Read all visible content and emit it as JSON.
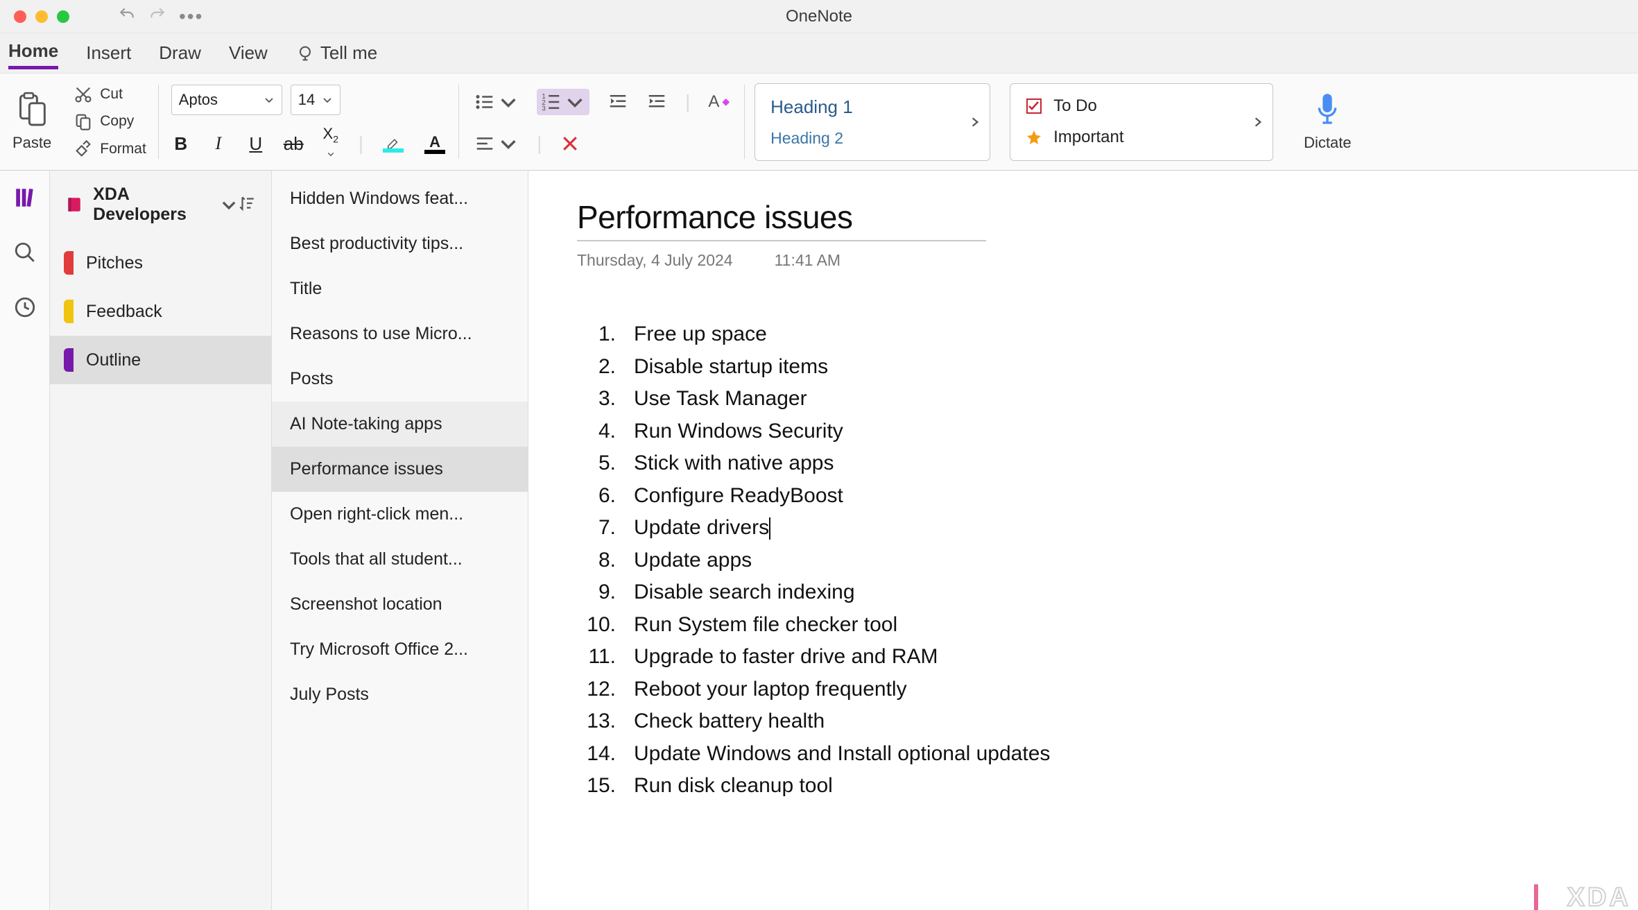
{
  "app": {
    "title": "OneNote"
  },
  "tabs": {
    "items": [
      "Home",
      "Insert",
      "Draw",
      "View"
    ],
    "tellme": "Tell me",
    "active": "Home"
  },
  "ribbon": {
    "paste": "Paste",
    "cut": "Cut",
    "copy": "Copy",
    "format": "Format",
    "font_name": "Aptos",
    "font_size": "14",
    "styles": {
      "heading1": "Heading 1",
      "heading2": "Heading 2"
    },
    "tags": {
      "todo": "To Do",
      "important": "Important"
    },
    "dictate": "Dictate"
  },
  "notebook": {
    "name": "XDA Developers"
  },
  "sections": [
    {
      "label": "Pitches",
      "color": "st-red"
    },
    {
      "label": "Feedback",
      "color": "st-yellow"
    },
    {
      "label": "Outline",
      "color": "st-purple",
      "active": true
    }
  ],
  "pages": [
    {
      "label": "Hidden Windows feat..."
    },
    {
      "label": "Best productivity tips..."
    },
    {
      "label": "Title"
    },
    {
      "label": "Reasons to use Micro..."
    },
    {
      "label": "Posts"
    },
    {
      "label": "AI Note-taking apps",
      "hover": true
    },
    {
      "label": "Performance issues",
      "active": true
    },
    {
      "label": "Open right-click men..."
    },
    {
      "label": "Tools that all student..."
    },
    {
      "label": "Screenshot location"
    },
    {
      "label": "Try Microsoft Office 2..."
    },
    {
      "label": "July Posts"
    }
  ],
  "page": {
    "title": "Performance issues",
    "date": "Thursday, 4 July 2024",
    "time": "11:41 AM",
    "list": [
      "Free up space",
      "Disable startup items",
      "Use Task Manager",
      "Run Windows Security",
      "Stick with native apps",
      "Configure ReadyBoost",
      "Update drivers",
      "Update apps",
      "Disable search indexing",
      "Run System file checker tool",
      "Upgrade to faster drive and RAM",
      "Reboot your laptop frequently",
      "Check battery health",
      "Update Windows and Install optional updates",
      "Run disk cleanup tool"
    ]
  },
  "watermark": "XDA"
}
